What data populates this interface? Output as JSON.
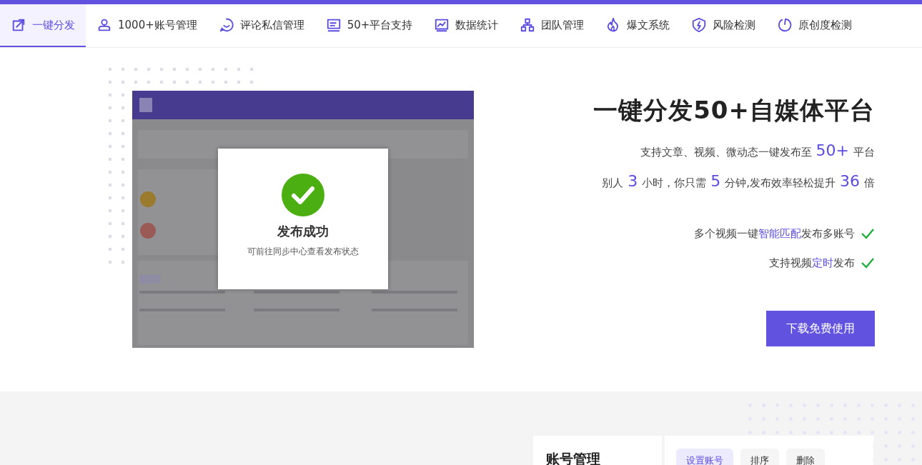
{
  "nav": {
    "tabs": [
      {
        "label": "一键分发",
        "selected": true
      },
      {
        "label": "1000+账号管理",
        "selected": false
      },
      {
        "label": "评论私信管理",
        "selected": false
      },
      {
        "label": "50+平台支持",
        "selected": false
      },
      {
        "label": "数据统计",
        "selected": false
      },
      {
        "label": "团队管理",
        "selected": false
      },
      {
        "label": "爆文系统",
        "selected": false
      },
      {
        "label": "风险检测",
        "selected": false
      },
      {
        "label": "原创度检测",
        "selected": false
      }
    ]
  },
  "hero": {
    "dialog": {
      "title": "发布成功",
      "message": "可前往同步中心查看发布状态"
    },
    "title": "一键分发50+自媒体平台",
    "lines": [
      [
        {
          "kind": "text",
          "text": "支持文章、视频、微动态一键发布至"
        },
        {
          "kind": "number",
          "text": "50+"
        },
        {
          "kind": "text",
          "text": "平台"
        }
      ],
      [
        {
          "kind": "text",
          "text": "别人"
        },
        {
          "kind": "number",
          "text": "3"
        },
        {
          "kind": "text",
          "text": "小时，你只需"
        },
        {
          "kind": "number",
          "text": "5"
        },
        {
          "kind": "text",
          "text": "分钟,发布效率轻松提升"
        },
        {
          "kind": "number",
          "text": "36"
        },
        {
          "kind": "text",
          "text": "倍"
        }
      ]
    ],
    "features": [
      {
        "checked": true,
        "parts": [
          {
            "kind": "text",
            "text": "多个视频一键"
          },
          {
            "kind": "accent",
            "text": "智能匹配"
          },
          {
            "kind": "text",
            "text": "发布多账号"
          }
        ]
      },
      {
        "checked": true,
        "parts": [
          {
            "kind": "text",
            "text": "支持视频"
          },
          {
            "kind": "accent",
            "text": "定时"
          },
          {
            "kind": "text",
            "text": "发布"
          }
        ]
      }
    ],
    "cta": "下载免费使用"
  },
  "section2": {
    "card_title": "账号管理",
    "buttons": [
      {
        "label": "设置账号",
        "selected": true
      },
      {
        "label": "排序",
        "selected": false
      },
      {
        "label": "删除",
        "selected": false
      }
    ]
  }
}
